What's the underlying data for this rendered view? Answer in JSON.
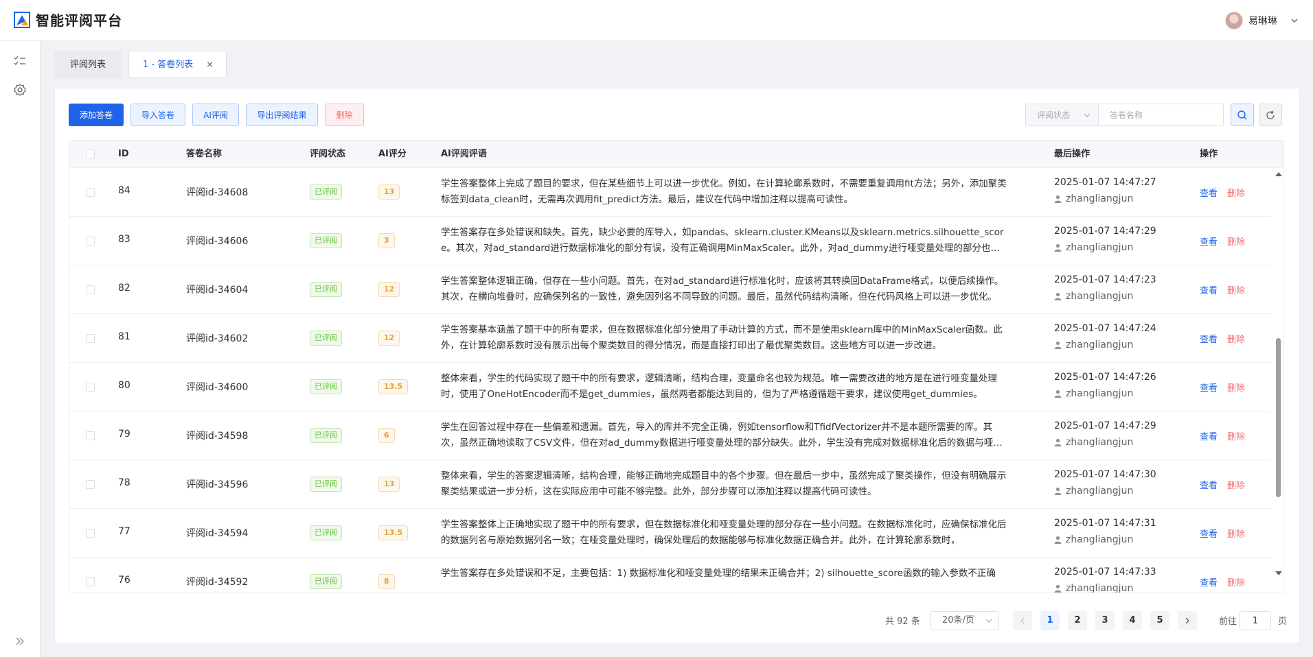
{
  "app": {
    "title": "智能评阅平台"
  },
  "user": {
    "name": "易琳琳"
  },
  "tabs": [
    {
      "label": "评阅列表"
    },
    {
      "label": "1 - 答卷列表",
      "close": "×"
    }
  ],
  "toolbar": {
    "add_label": "添加答卷",
    "import_label": "导入答卷",
    "ai_label": "AI评阅",
    "export_label": "导出评阅结果",
    "delete_label": "删除"
  },
  "filter": {
    "status_placeholder": "评阅状态",
    "name_placeholder": "答卷名称"
  },
  "table": {
    "headers": {
      "id": "ID",
      "name": "答卷名称",
      "status": "评阅状态",
      "score": "AI评分",
      "comment": "AI评阅评语",
      "last_op": "最后操作",
      "actions": "操作"
    },
    "view_label": "查看",
    "delete_label": "删除",
    "rows": [
      {
        "id": "84",
        "name": "评阅id-34608",
        "status": "已评阅",
        "score": "13",
        "comment": "学生答案整体上完成了题目的要求，但在某些细节上可以进一步优化。例如，在计算轮廓系数时，不需要重复调用fit方法；另外，添加聚类标签到data_clean时，无需再次调用fit_predict方法。最后，建议在代码中增加注释以提高可读性。",
        "time": "2025-01-07 14:47:27",
        "user": "zhangliangjun"
      },
      {
        "id": "83",
        "name": "评阅id-34606",
        "status": "已评阅",
        "score": "3",
        "comment": "学生答案存在多处错误和缺失。首先，缺少必要的库导入，如pandas、sklearn.cluster.KMeans以及sklearn.metrics.silhouette_score。其次，对ad_standard进行数据标准化的部分有误，没有正确调用MinMaxScaler。此外，对ad_dummy进行哑变量处理的部分也存在问题。",
        "time": "2025-01-07 14:47:29",
        "user": "zhangliangjun"
      },
      {
        "id": "82",
        "name": "评阅id-34604",
        "status": "已评阅",
        "score": "12",
        "comment": "学生答案整体逻辑正确，但存在一些小问题。首先，在对ad_standard进行标准化时，应该将其转换回DataFrame格式，以便后续操作。其次，在横向堆叠时，应确保列名的一致性，避免因列名不同导致的问题。最后，虽然代码结构清晰，但在代码风格上可以进一步优化。",
        "time": "2025-01-07 14:47:23",
        "user": "zhangliangjun"
      },
      {
        "id": "81",
        "name": "评阅id-34602",
        "status": "已评阅",
        "score": "12",
        "comment": "学生答案基本涵盖了题干中的所有要求，但在数据标准化部分使用了手动计算的方式，而不是使用sklearn库中的MinMaxScaler函数。此外，在计算轮廓系数时没有展示出每个聚类数目的得分情况，而是直接打印出了最优聚类数目。这些地方可以进一步改进。",
        "time": "2025-01-07 14:47:24",
        "user": "zhangliangjun"
      },
      {
        "id": "80",
        "name": "评阅id-34600",
        "status": "已评阅",
        "score": "13.5",
        "comment": "整体来看，学生的代码实现了题干中的所有要求，逻辑清晰，结构合理，变量命名也较为规范。唯一需要改进的地方是在进行哑变量处理时，使用了OneHotEncoder而不是get_dummies，虽然两者都能达到目的，但为了严格遵循题干要求，建议使用get_dummies。",
        "time": "2025-01-07 14:47:26",
        "user": "zhangliangjun"
      },
      {
        "id": "79",
        "name": "评阅id-34598",
        "status": "已评阅",
        "score": "6",
        "comment": "学生在回答过程中存在一些偏差和遗漏。首先，导入的库并不完全正确，例如tensorflow和TfidfVectorizer并不是本题所需要的库。其次，虽然正确地读取了CSV文件，但在对ad_dummy数据进行哑变量处理的部分缺失。此外，学生没有完成对数据标准化后的数据与哑变量数据的合并。",
        "time": "2025-01-07 14:47:29",
        "user": "zhangliangjun"
      },
      {
        "id": "78",
        "name": "评阅id-34596",
        "status": "已评阅",
        "score": "13",
        "comment": "整体来看，学生的答案逻辑清晰，结构合理，能够正确地完成题目中的各个步骤。但在最后一步中，虽然完成了聚类操作，但没有明确展示聚类结果或进一步分析，这在实际应用中可能不够完整。此外，部分步骤可以添加注释以提高代码可读性。",
        "time": "2025-01-07 14:47:30",
        "user": "zhangliangjun"
      },
      {
        "id": "77",
        "name": "评阅id-34594",
        "status": "已评阅",
        "score": "13.5",
        "comment": "学生答案整体上正确地实现了题干中的所有要求，但在数据标准化和哑变量处理的部分存在一些小问题。在数据标准化时，应确保标准化后的数据列名与原始数据列名一致；在哑变量处理时，确保处理后的数据能够与标准化数据正确合并。此外，在计算轮廓系数时，",
        "time": "2025-01-07 14:47:31",
        "user": "zhangliangjun"
      },
      {
        "id": "76",
        "name": "评阅id-34592",
        "status": "已评阅",
        "score": "8",
        "comment": "学生答案存在多处错误和不足，主要包括：1) 数据标准化和哑变量处理的结果未正确合并；2) silhouette_score函数的输入参数不正确",
        "time": "2025-01-07 14:47:33",
        "user": "zhangliangjun"
      }
    ]
  },
  "pagination": {
    "total_text": "共 92 条",
    "page_size": "20条/页",
    "pages": [
      "1",
      "2",
      "3",
      "4",
      "5"
    ],
    "current": "1",
    "goto_label": "前往",
    "goto_value": "1",
    "goto_unit": "页"
  },
  "colors": {
    "primary": "#1e63e8",
    "success": "#67c23a",
    "warning": "#e6a23c",
    "danger": "#f56c6c"
  }
}
